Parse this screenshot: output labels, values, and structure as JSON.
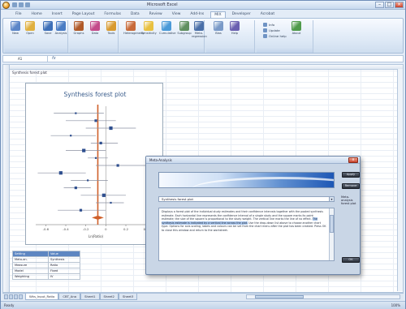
{
  "window": {
    "title": "Microsoft Excel"
  },
  "ribbon": {
    "tabs": [
      "File",
      "Home",
      "Insert",
      "Page Layout",
      "Formulas",
      "Data",
      "Review",
      "View",
      "Add-Ins",
      "MIX",
      "Developer",
      "Acrobat"
    ],
    "active_tab": "MIX",
    "buttons": [
      {
        "label": "New",
        "color": "#5b86c8"
      },
      {
        "label": "Open",
        "color": "#e0b040"
      },
      {
        "label": "Save",
        "color": "#3d6fb8"
      },
      {
        "label": "Analysis",
        "color": "#4a7cc4"
      },
      {
        "label": "Graphs",
        "color": "#b05a2a"
      },
      {
        "label": "Data",
        "color": "#c44a8a"
      },
      {
        "label": "Tools",
        "color": "#d89a30"
      },
      {
        "label": "Heterogeneity",
        "color": "#c86a3a"
      },
      {
        "label": "Sensitivity",
        "color": "#e8c040"
      },
      {
        "label": "Cumulative",
        "color": "#4a9ad8"
      },
      {
        "label": "Subgroup",
        "color": "#5f8f5f"
      },
      {
        "label": "Meta-regression",
        "color": "#4a6fa8"
      },
      {
        "label": "Bias",
        "color": "#7a9ac8"
      },
      {
        "label": "Help",
        "color": "#6a5fb0"
      },
      {
        "label": "About",
        "color": "#4f9a4a"
      }
    ],
    "small_items": [
      "Info",
      "Update",
      "Online help"
    ]
  },
  "formula_bar": {
    "name_box": "A1",
    "fx": "fx"
  },
  "sheet": {
    "a1_text": "Synthesis forest plot"
  },
  "chart_data": {
    "type": "scatter",
    "title": "Synthesis forest plot",
    "xlabel": "Ln(Ratio)",
    "xticks": [
      "-0.6",
      "-0.4",
      "-0.2",
      "0",
      "0.2",
      "0.4"
    ],
    "xlim": [
      -0.7,
      0.5
    ],
    "reference_line": 0,
    "summary_line": -0.08,
    "studies": [
      {
        "est": -0.3,
        "lo": -0.52,
        "hi": -0.02
      },
      {
        "est": -0.1,
        "lo": -0.4,
        "hi": 0.1
      },
      {
        "est": 0.05,
        "lo": -0.2,
        "hi": 0.3
      },
      {
        "est": -0.35,
        "lo": -0.55,
        "hi": -0.1
      },
      {
        "est": -0.05,
        "lo": -0.15,
        "hi": 0.12
      },
      {
        "est": -0.22,
        "lo": -0.4,
        "hi": 0.0
      },
      {
        "est": -0.1,
        "lo": -0.18,
        "hi": 0.02
      },
      {
        "est": 0.12,
        "lo": -0.1,
        "hi": 0.4
      },
      {
        "est": -0.45,
        "lo": -0.68,
        "hi": -0.2
      },
      {
        "est": -0.18,
        "lo": -0.35,
        "hi": 0.02
      },
      {
        "est": -0.3,
        "lo": -0.42,
        "hi": -0.15
      },
      {
        "est": -0.02,
        "lo": -0.25,
        "hi": 0.2
      },
      {
        "est": 0.05,
        "lo": -0.1,
        "hi": 0.18
      },
      {
        "est": -0.25,
        "lo": -0.48,
        "hi": 0.0
      }
    ],
    "summary": {
      "est": -0.08,
      "lo": -0.14,
      "hi": -0.02
    },
    "colors": {
      "ci": "#8a8fa0",
      "point": "#2f4f8f",
      "summary_line": "#d0602a",
      "zero_line": "#9a9a9a"
    }
  },
  "summary_table": {
    "header": [
      "Setting",
      "Value"
    ],
    "rows": [
      [
        "Meta-an.",
        "Synthesis"
      ],
      [
        "Measure",
        "Ratio"
      ],
      [
        "Model",
        "Fixed"
      ],
      [
        "Weighting",
        "IV"
      ]
    ]
  },
  "sheet_tabs": [
    "Wks_Input_Ratio",
    "CBT_Ana",
    "Sheet1",
    "Sheet2",
    "Sheet3"
  ],
  "active_sheet": "Wks_Input_Ratio",
  "status": {
    "left": "Ready",
    "zoom": "100%"
  },
  "dialog": {
    "title": "Meta-Analysis",
    "close": "x",
    "select_value": "Synthesis forest plot",
    "side_label": "Meta-analysis forest plot",
    "buttons": {
      "apply": "Apply",
      "remove": "Remove",
      "ok": "OK"
    },
    "text_before": "Displays a forest plot of the individual study estimates and their confidence intervals together with the pooled synthesis estimate. Each horizontal line represents the confidence interval of a single study and the square marks its point estimate; the size of the square is proportional to the study weight. The vertical line marks the line of no effect. ",
    "text_highlight": "The synthesis estimate is indicated by a vertical line across the plot.",
    "text_after": " Use the drop-down list above to choose another chart type. Options for axis scaling, labels and colours can be set from the chart menu after the plot has been created. Press OK to close this window and return to the worksheet."
  }
}
